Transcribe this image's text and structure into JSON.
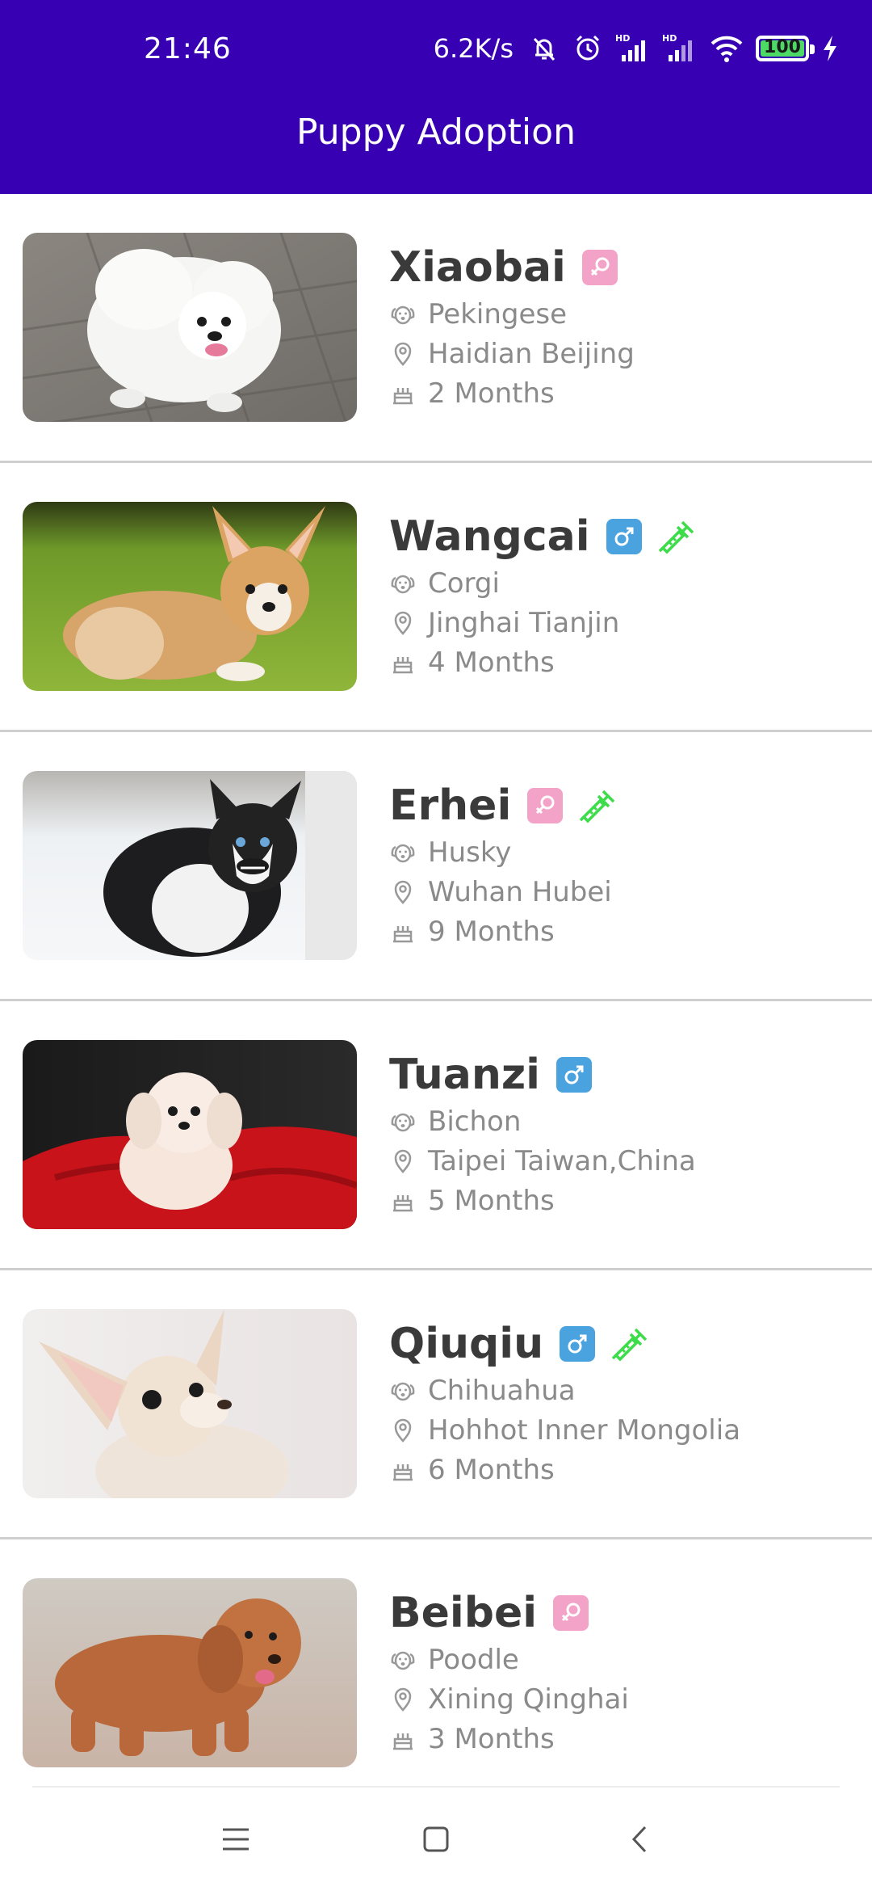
{
  "status_bar": {
    "time": "21:46",
    "network_speed": "6.2K/s",
    "battery_level": "100",
    "icons": [
      "mute-bell-icon",
      "alarm-icon",
      "hd-signal-icon",
      "hd-signal-icon",
      "wifi-icon",
      "battery-icon",
      "charging-bolt-icon"
    ]
  },
  "toolbar": {
    "title": "Puppy Adoption",
    "color": "#3700b3"
  },
  "puppies": [
    {
      "name": "Xiaobai",
      "gender": "female",
      "vaccinated": false,
      "breed": "Pekingese",
      "location": "Haidian Beijing",
      "age": "2 Months"
    },
    {
      "name": "Wangcai",
      "gender": "male",
      "vaccinated": true,
      "breed": "Corgi",
      "location": "Jinghai Tianjin",
      "age": "4 Months"
    },
    {
      "name": "Erhei",
      "gender": "female",
      "vaccinated": true,
      "breed": "Husky",
      "location": "Wuhan Hubei",
      "age": "9 Months"
    },
    {
      "name": "Tuanzi",
      "gender": "male",
      "vaccinated": false,
      "breed": "Bichon",
      "location": "Taipei Taiwan,China",
      "age": "5 Months"
    },
    {
      "name": "Qiuqiu",
      "gender": "male",
      "vaccinated": true,
      "breed": "Chihuahua",
      "location": "Hohhot Inner Mongolia",
      "age": "6 Months"
    },
    {
      "name": "Beibei",
      "gender": "female",
      "vaccinated": false,
      "breed": "Poodle",
      "location": "Xining Qinghai",
      "age": "3 Months"
    }
  ],
  "colors": {
    "female_badge": "#f4a3c8",
    "male_badge": "#4aa3df",
    "vaccine": "#3ddc4a"
  },
  "nav": {
    "icons": [
      "menu-icon",
      "home-icon",
      "back-icon"
    ]
  }
}
